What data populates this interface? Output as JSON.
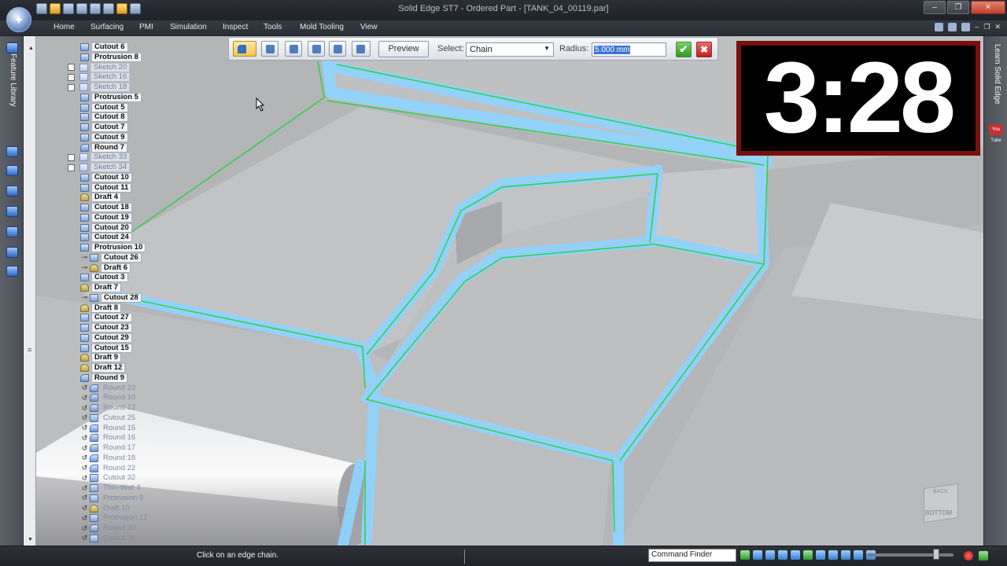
{
  "window": {
    "title": "Solid Edge ST7 - Ordered Part - [TANK_04_00119.par]",
    "controls": [
      "–",
      "❐",
      "✕"
    ]
  },
  "ribbon": {
    "tabs": [
      "Home",
      "Surfacing",
      "PMI",
      "Simulation",
      "Inspect",
      "Tools",
      "Mold Tooling",
      "View"
    ],
    "right_controls": [
      "–",
      "❐",
      "✕"
    ]
  },
  "left_panel": {
    "tab_label": "Feature Library"
  },
  "right_panel": {
    "tab_label": "Learn Solid Edge",
    "youtube_label": "You Tube"
  },
  "command_bar": {
    "preview_label": "Preview",
    "select_label": "Select:",
    "select_value": "Chain",
    "radius_label": "Radius:",
    "radius_value": "5.000 mm",
    "ok_label": "✔",
    "cancel_label": "✖"
  },
  "feature_tree": [
    {
      "label": "Cutout 6",
      "state": "active"
    },
    {
      "label": "Protrusion 8",
      "state": "active"
    },
    {
      "label": "Sketch 20",
      "state": "sketch"
    },
    {
      "label": "Sketch 16",
      "state": "sketch"
    },
    {
      "label": "Sketch 18",
      "state": "sketch"
    },
    {
      "label": "Protrusion 5",
      "state": "active"
    },
    {
      "label": "Cutout 5",
      "state": "active"
    },
    {
      "label": "Cutout 8",
      "state": "active"
    },
    {
      "label": "Cutout 7",
      "state": "active"
    },
    {
      "label": "Cutout 9",
      "state": "active"
    },
    {
      "label": "Round 7",
      "state": "active"
    },
    {
      "label": "Sketch 33",
      "state": "sketch"
    },
    {
      "label": "Sketch 34",
      "state": "sketch"
    },
    {
      "label": "Cutout 10",
      "state": "active"
    },
    {
      "label": "Cutout 11",
      "state": "active"
    },
    {
      "label": "Draft 4",
      "state": "active"
    },
    {
      "label": "Cutout 18",
      "state": "active"
    },
    {
      "label": "Cutout 19",
      "state": "active"
    },
    {
      "label": "Cutout 20",
      "state": "active"
    },
    {
      "label": "Cutout 24",
      "state": "active"
    },
    {
      "label": "Protrusion 10",
      "state": "active"
    },
    {
      "label": "Cutout 26",
      "state": "child"
    },
    {
      "label": "Draft 6",
      "state": "child"
    },
    {
      "label": "Cutout 3",
      "state": "active"
    },
    {
      "label": "Draft 7",
      "state": "active"
    },
    {
      "label": "Cutout 28",
      "state": "child"
    },
    {
      "label": "Draft 8",
      "state": "active"
    },
    {
      "label": "Cutout 27",
      "state": "active"
    },
    {
      "label": "Cutout 23",
      "state": "active"
    },
    {
      "label": "Cutout 29",
      "state": "active"
    },
    {
      "label": "Cutout 15",
      "state": "active"
    },
    {
      "label": "Draft 9",
      "state": "active"
    },
    {
      "label": "Draft 12",
      "state": "active"
    },
    {
      "label": "Round 9",
      "state": "active"
    },
    {
      "label": "Round 23",
      "state": "rolled"
    },
    {
      "label": "Round 10",
      "state": "rolled"
    },
    {
      "label": "Round 12",
      "state": "rolled"
    },
    {
      "label": "Cutout 25",
      "state": "rolled"
    },
    {
      "label": "Round 15",
      "state": "rolled"
    },
    {
      "label": "Round 16",
      "state": "rolled"
    },
    {
      "label": "Round 17",
      "state": "rolled"
    },
    {
      "label": "Round 18",
      "state": "rolled"
    },
    {
      "label": "Round 22",
      "state": "rolled"
    },
    {
      "label": "Cutout 32",
      "state": "rolled"
    },
    {
      "label": "Thin-Wall 4",
      "state": "rolled"
    },
    {
      "label": "Protrusion 9",
      "state": "rolled"
    },
    {
      "label": "Draft 10",
      "state": "rolled"
    },
    {
      "label": "Protrusion 12",
      "state": "rolled"
    },
    {
      "label": "Round 20",
      "state": "rolled"
    },
    {
      "label": "Cutout 31",
      "state": "rolled"
    }
  ],
  "timer": {
    "value": "3:28"
  },
  "view_cube": {
    "back": "BACK",
    "bottom": "BOTTOM"
  },
  "status_bar": {
    "prompt": "Click on an edge chain.",
    "command_finder": "Command Finder"
  },
  "colors": {
    "highlight_edge": "#8fd4ff",
    "selected_edge": "#2bd14a",
    "timer_border": "#7a0f0f"
  }
}
